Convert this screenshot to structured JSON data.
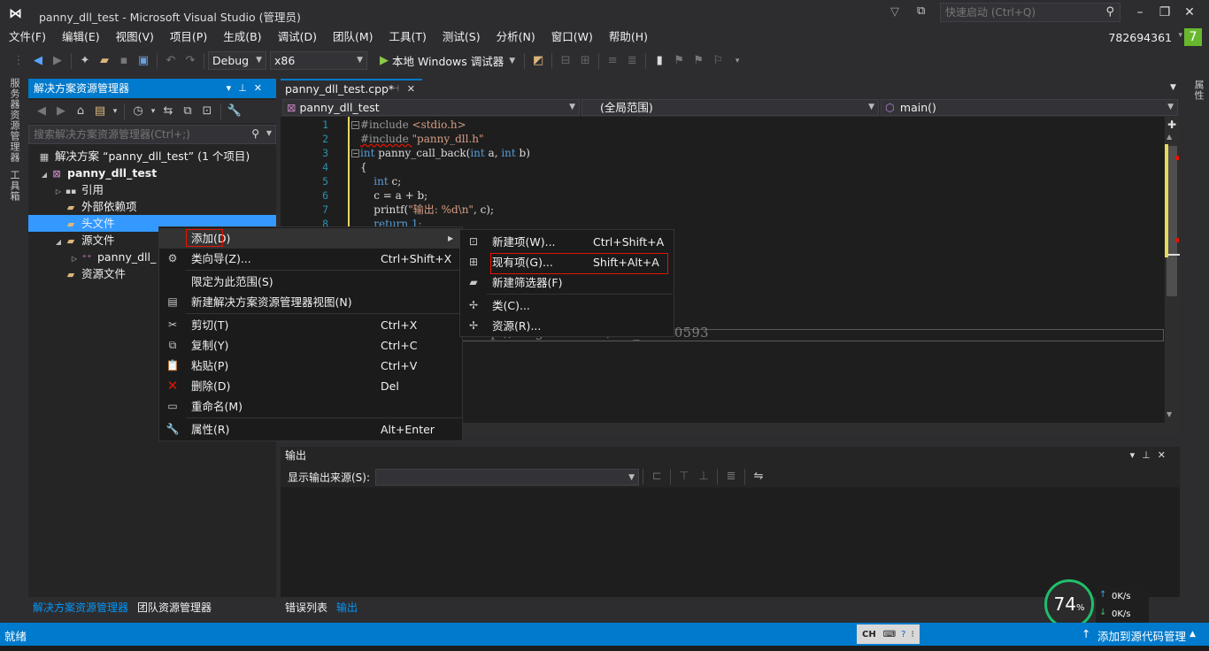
{
  "window": {
    "title": "panny_dll_test - Microsoft Visual Studio (管理员)",
    "quick_launch_placeholder": "快速启动 (Ctrl+Q)",
    "account": "782694361",
    "notification_count": "7"
  },
  "menubar": [
    "文件(F)",
    "编辑(E)",
    "视图(V)",
    "项目(P)",
    "生成(B)",
    "调试(D)",
    "团队(M)",
    "工具(T)",
    "测试(S)",
    "分析(N)",
    "窗口(W)",
    "帮助(H)"
  ],
  "toolbar": {
    "config": "Debug",
    "platform": "x86",
    "run_label": "本地 Windows 调试器"
  },
  "left_vtabs": [
    "服务器资源管理器",
    "工具箱"
  ],
  "right_vtabs": [
    "属性"
  ],
  "solution_explorer": {
    "title": "解决方案资源管理器",
    "search_placeholder": "搜索解决方案资源管理器(Ctrl+;)",
    "tree": [
      {
        "label": "解决方案 “panny_dll_test” (1 个项目)",
        "icon": "solution-icon"
      },
      {
        "label": "panny_dll_test",
        "icon": "project-icon"
      },
      {
        "label": "引用",
        "icon": "references-icon"
      },
      {
        "label": "外部依赖项",
        "icon": "folder-icon"
      },
      {
        "label": "头文件",
        "icon": "folder-icon",
        "selected": true
      },
      {
        "label": "源文件",
        "icon": "folder-icon"
      },
      {
        "label": "panny_dll_",
        "icon": "cpp-file-icon"
      },
      {
        "label": "资源文件",
        "icon": "folder-icon"
      }
    ],
    "bottom_tabs": [
      "解决方案资源管理器",
      "团队资源管理器"
    ]
  },
  "editor": {
    "tab_label": "panny_dll_test.cpp*",
    "nav_project": "panny_dll_test",
    "nav_scope": "(全局范围)",
    "nav_member": "main()",
    "line_numbers": [
      "1",
      "2",
      "3",
      "4",
      "5",
      "6",
      "7",
      "8"
    ],
    "code": {
      "l1a": "#include ",
      "l1b": "<stdio.h>",
      "l2a": "#include ",
      "l2b": "\"panny_dll.h\"",
      "l3a": "int",
      "l3b": " panny_call_back(",
      "l3c": "int",
      "l3d": " a, ",
      "l3e": "int",
      "l3f": " b)",
      "l4": "{",
      "l5a": "    int",
      "l5b": " c;",
      "l6": "    c = a + b;",
      "l7a": "    printf(",
      "l7b": "\"输出: %d\\n\"",
      "l7c": ", c);",
      "l8": "    return 1;"
    },
    "watermark": "http://blog.csdn.net/m0_37170593"
  },
  "context_menu": {
    "items": [
      {
        "label": "添加(D)",
        "shortcut": "",
        "icon": ""
      },
      {
        "label": "类向导(Z)...",
        "shortcut": "Ctrl+Shift+X",
        "icon": "class-wizard-icon"
      },
      {
        "label": "限定为此范围(S)",
        "shortcut": "",
        "icon": ""
      },
      {
        "label": "新建解决方案资源管理器视图(N)",
        "shortcut": "",
        "icon": "new-view-icon"
      },
      {
        "label": "剪切(T)",
        "shortcut": "Ctrl+X",
        "icon": "scissors-icon"
      },
      {
        "label": "复制(Y)",
        "shortcut": "Ctrl+C",
        "icon": "copy-icon"
      },
      {
        "label": "粘贴(P)",
        "shortcut": "Ctrl+V",
        "icon": "paste-icon"
      },
      {
        "label": "删除(D)",
        "shortcut": "Del",
        "icon": "delete-icon"
      },
      {
        "label": "重命名(M)",
        "shortcut": "",
        "icon": "rename-icon"
      },
      {
        "label": "属性(R)",
        "shortcut": "Alt+Enter",
        "icon": "wrench-icon"
      }
    ]
  },
  "submenu": {
    "items": [
      {
        "label": "新建项(W)...",
        "shortcut": "Ctrl+Shift+A",
        "icon": "new-item-icon"
      },
      {
        "label": "现有项(G)...",
        "shortcut": "Shift+Alt+A",
        "icon": "existing-item-icon"
      },
      {
        "label": "新建筛选器(F)",
        "shortcut": "",
        "icon": "new-filter-icon"
      },
      {
        "label": "类(C)...",
        "shortcut": "",
        "icon": "class-icon"
      },
      {
        "label": "资源(R)...",
        "shortcut": "",
        "icon": "resource-icon"
      }
    ]
  },
  "output": {
    "title": "输出",
    "source_label": "显示输出来源(S):",
    "source_value": "",
    "bottom_tabs": [
      "错误列表",
      "输出"
    ]
  },
  "status": {
    "left": "就绪",
    "ime": "CH",
    "right": "添加到源代码管理"
  },
  "net_widget": {
    "percent": "74",
    "percent_unit": "%",
    "up": "0K/s",
    "down": "0K/s"
  },
  "colors": {
    "accent": "#007acc",
    "background": "#2d2d30",
    "editor_bg": "#1e1e1e",
    "highlight_box": "#e51400",
    "selection": "#3399ff"
  }
}
